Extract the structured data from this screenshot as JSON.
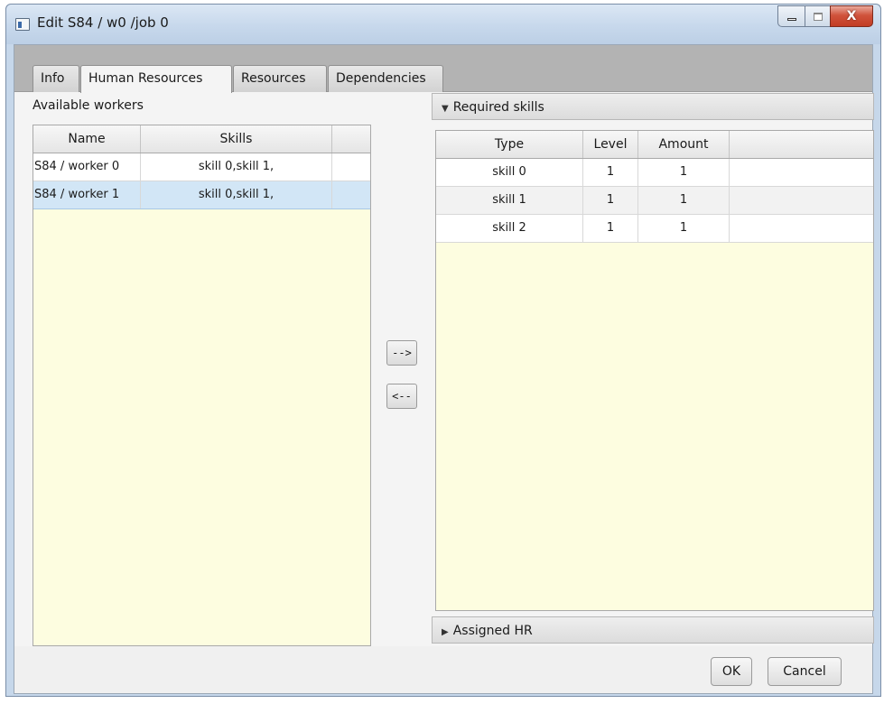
{
  "window": {
    "title": "Edit S84 / w0 /job 0",
    "close_glyph": "X"
  },
  "tabs": [
    {
      "label": "Info",
      "active": false
    },
    {
      "label": "Human Resources",
      "active": true
    },
    {
      "label": "Resources",
      "active": false
    },
    {
      "label": "Dependencies",
      "active": false
    }
  ],
  "workers": {
    "label": "Available workers",
    "columns": [
      "Name",
      "Skills"
    ],
    "rows": [
      {
        "name": "S84 / worker 0",
        "skills": "skill 0,skill 1,",
        "selected": false
      },
      {
        "name": "S84 / worker 1",
        "skills": "skill 0,skill 1,",
        "selected": true
      }
    ]
  },
  "move": {
    "assign_label": "-->",
    "unassign_label": "<--"
  },
  "required_skills": {
    "label": "Required skills",
    "expanded": true,
    "columns": [
      "Type",
      "Level",
      "Amount"
    ],
    "rows": [
      {
        "type": "skill 0",
        "level": "1",
        "amount": "1"
      },
      {
        "type": "skill 1",
        "level": "1",
        "amount": "1"
      },
      {
        "type": "skill 2",
        "level": "1",
        "amount": "1"
      }
    ]
  },
  "assigned_hr": {
    "label": "Assigned HR",
    "expanded": false
  },
  "footer": {
    "ok_label": "OK",
    "cancel_label": "Cancel"
  },
  "colors": {
    "table_empty_bg": "#fdfde0",
    "selection_bg": "#d2e6f6",
    "tabbar_bg": "#b3b3b3"
  },
  "icons": [
    "app-window-icon",
    "minimize-icon",
    "maximize-icon",
    "close-icon",
    "triangle-down-icon",
    "triangle-right-icon"
  ]
}
